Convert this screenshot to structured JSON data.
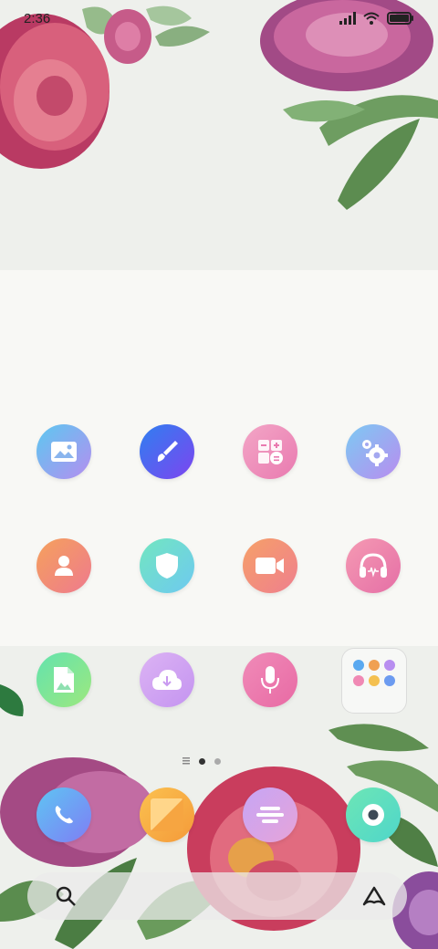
{
  "status_bar": {
    "time": "2:36",
    "icons": [
      "signal-icon",
      "wifi-icon",
      "battery-icon"
    ]
  },
  "home_grid": [
    {
      "name": "gallery",
      "icon": "image-icon",
      "colors": [
        "#5cc8f0",
        "#b58ef0"
      ]
    },
    {
      "name": "themes",
      "icon": "brush-icon",
      "colors": [
        "#2f7ff0",
        "#7d45f0"
      ]
    },
    {
      "name": "calculator",
      "icon": "calculator-icon",
      "colors": [
        "#f3a6c6",
        "#e97ab0"
      ]
    },
    {
      "name": "settings",
      "icon": "gear-icon",
      "colors": [
        "#7ccaf2",
        "#b98cf0"
      ]
    },
    {
      "name": "contacts",
      "icon": "person-icon",
      "colors": [
        "#f5a15c",
        "#ee7a8e"
      ]
    },
    {
      "name": "security",
      "icon": "shield-icon",
      "colors": [
        "#72e6c0",
        "#6ec9f0"
      ]
    },
    {
      "name": "video",
      "icon": "video-camera-icon",
      "colors": [
        "#f6a068",
        "#ef7f8e"
      ]
    },
    {
      "name": "music",
      "icon": "headphones-icon",
      "colors": [
        "#f59ab3",
        "#e56fa6"
      ]
    },
    {
      "name": "files",
      "icon": "document-icon",
      "colors": [
        "#63e3ae",
        "#9de87e"
      ]
    },
    {
      "name": "downloads",
      "icon": "cloud-download-icon",
      "colors": [
        "#dcb3f4",
        "#c494f0"
      ]
    },
    {
      "name": "recorder",
      "icon": "microphone-icon",
      "colors": [
        "#f08bb8",
        "#e86aa4"
      ]
    }
  ],
  "folder": {
    "icon": "folder-icon",
    "mini_icons": [
      "#5aa9f0",
      "#f0a052",
      "#b88ef0",
      "#f089b4",
      "#f4c050",
      "#6c9bf0"
    ]
  },
  "page_indicator": {
    "current": 1,
    "total": 2
  },
  "dock": [
    {
      "name": "phone",
      "icon": "phone-icon",
      "colors": [
        "#5ec5f3",
        "#7f7df4"
      ]
    },
    {
      "name": "notes",
      "icon": "notes-icon",
      "colors": [
        "#fbc14f",
        "#f49a3a"
      ]
    },
    {
      "name": "browser",
      "icon": "browser-icon",
      "colors": [
        "#c6a5f5",
        "#e6a4d9"
      ]
    },
    {
      "name": "camera",
      "icon": "camera-icon",
      "colors": [
        "#6de6b5",
        "#4fd6ca"
      ]
    }
  ],
  "search_bar": {
    "icon": "search-icon",
    "assistant_icon": "assistant-icon"
  }
}
